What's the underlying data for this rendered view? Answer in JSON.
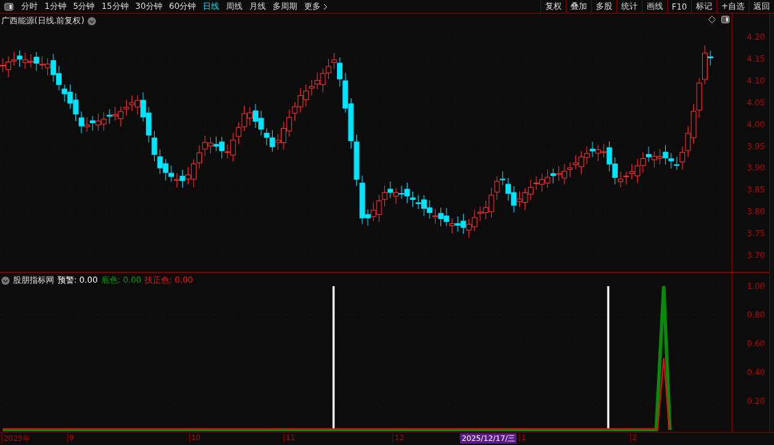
{
  "toolbar": {
    "periods": [
      {
        "label": "分时",
        "selected": false
      },
      {
        "label": "1分钟",
        "selected": false
      },
      {
        "label": "5分钟",
        "selected": false
      },
      {
        "label": "15分钟",
        "selected": false
      },
      {
        "label": "30分钟",
        "selected": false
      },
      {
        "label": "60分钟",
        "selected": false
      },
      {
        "label": "日线",
        "selected": true
      },
      {
        "label": "周线",
        "selected": false
      },
      {
        "label": "月线",
        "selected": false
      },
      {
        "label": "多周期",
        "selected": false
      },
      {
        "label": "更多",
        "selected": false
      }
    ],
    "actions": [
      "复权",
      "叠加",
      "多股",
      "统计",
      "画线",
      "F10",
      "标记",
      "+自选",
      "返回"
    ]
  },
  "chart": {
    "title": "广西能源(日线.前复权)",
    "y_ticks": [
      "4.20",
      "4.15",
      "4.10",
      "4.05",
      "4.00",
      "3.95",
      "3.90",
      "3.85",
      "3.80",
      "3.75",
      "3.70"
    ]
  },
  "indicator": {
    "name": "股朋指标网",
    "values": [
      {
        "text": "预警: 0.00",
        "color": "#ffffff"
      },
      {
        "text": "底色: 0.00",
        "color": "#00a000"
      },
      {
        "text": "扶正色: 0.00",
        "color": "#ff1010"
      }
    ],
    "y_ticks": [
      "1.00",
      "0.80",
      "0.60",
      "0.40",
      "0.20"
    ]
  },
  "date_axis": {
    "labels": [
      {
        "text": "2025年",
        "selected": false
      },
      {
        "text": "9",
        "selected": false
      },
      {
        "text": "10",
        "selected": false
      },
      {
        "text": "11",
        "selected": false
      },
      {
        "text": "12",
        "selected": false
      },
      {
        "text": "2025/12/17/三",
        "selected": true
      },
      {
        "text": "1",
        "selected": false
      },
      {
        "text": "2",
        "selected": false
      }
    ]
  }
}
